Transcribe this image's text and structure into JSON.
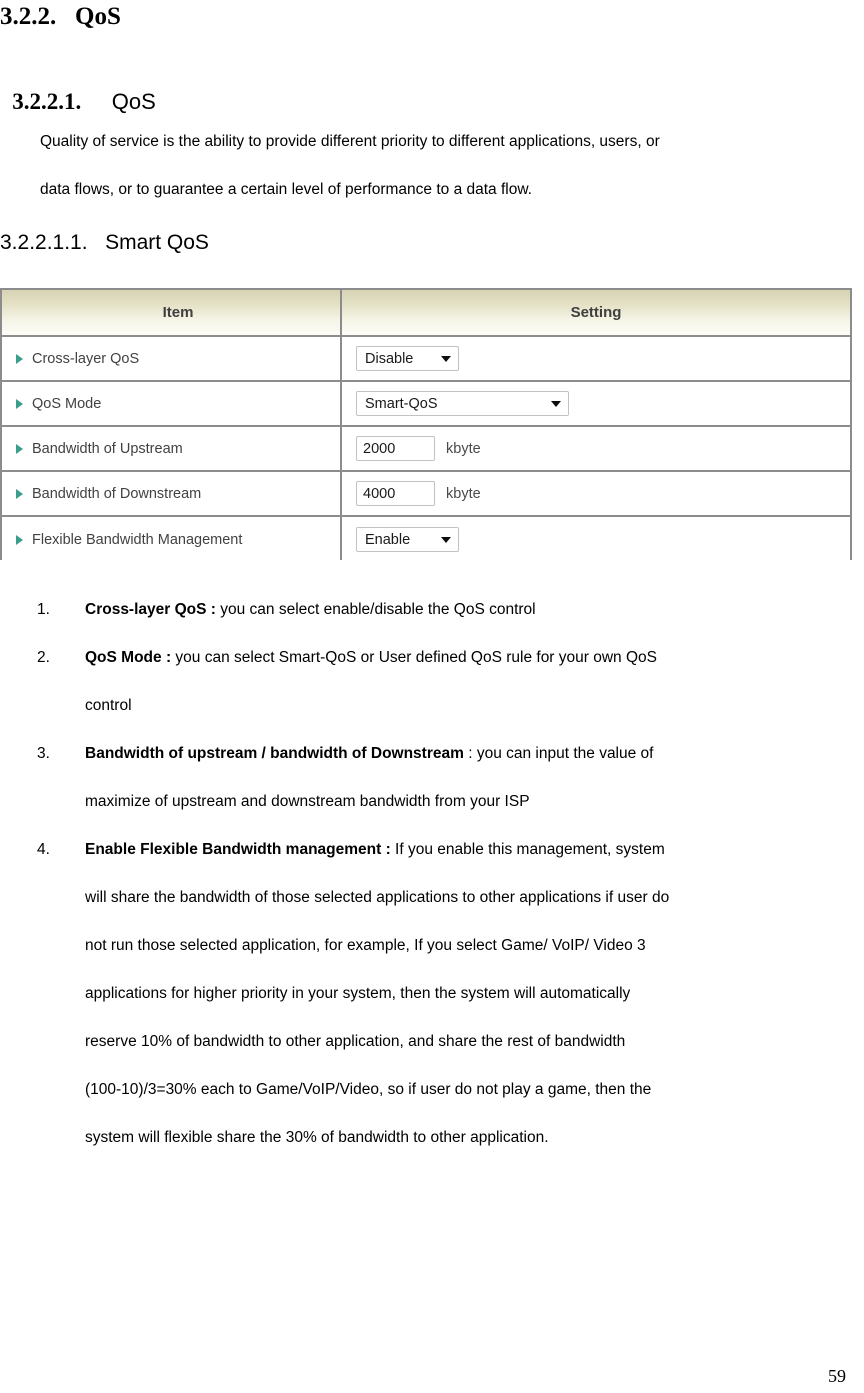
{
  "document": {
    "heading_l2": "3.2.2.   QoS",
    "heading_l3_number": "3.2.2.1.",
    "heading_l3_text": "QoS",
    "heading_l4": "3.2.2.1.1.   Smart QoS",
    "intro_lines": [
      "Quality of service is the ability to provide different priority to different applications, users, or",
      "data flows, or to guarantee a certain level of performance to a data flow."
    ],
    "page_number": "59"
  },
  "settings_table": {
    "columns": [
      "Item",
      "Setting"
    ],
    "rows": [
      {
        "label": "Cross-layer QoS",
        "control": "select",
        "value": "Disable",
        "unit": ""
      },
      {
        "label": "QoS Mode",
        "control": "select-wide",
        "value": "Smart-QoS",
        "unit": ""
      },
      {
        "label": "Bandwidth of Upstream",
        "control": "text",
        "value": "2000",
        "unit": "kbyte"
      },
      {
        "label": "Bandwidth of Downstream",
        "control": "text",
        "value": "4000",
        "unit": "kbyte"
      },
      {
        "label": "Flexible Bandwidth Management",
        "control": "select",
        "value": "Enable",
        "unit": ""
      }
    ],
    "colors": {
      "header_gradient_top": "#d6d3b4",
      "header_gradient_bottom": "#fdfdf7",
      "border": "#8c8c8c",
      "bullet_arrow": "#3a9e8a",
      "label_text": "#424242"
    }
  },
  "notes": [
    {
      "number": "1.",
      "term": "Cross-layer QoS :",
      "lines": [
        " you can select enable/disable the QoS control"
      ]
    },
    {
      "number": "2.",
      "term": "QoS Mode :",
      "lines": [
        " you can select Smart-QoS or User defined QoS rule for your own QoS",
        "control"
      ]
    },
    {
      "number": "3.",
      "term": "Bandwidth of upstream / bandwidth of Downstream",
      "lines": [
        " : you can input the value of",
        "maximize of upstream and downstream bandwidth from your ISP"
      ]
    },
    {
      "number": "4.",
      "term": "Enable Flexible Bandwidth management :",
      "lines": [
        " If you enable this management, system",
        "will share the bandwidth of those selected applications to other applications if user do",
        "not run those selected application, for example, If you select Game/ VoIP/ Video 3",
        "applications for higher priority in your system, then the system will automatically",
        "reserve 10% of bandwidth to other application, and share the rest of bandwidth",
        "(100-10)/3=30% each to Game/VoIP/Video, so if user do not play a game, then the",
        "system will flexible share the 30% of bandwidth to other application."
      ]
    }
  ]
}
